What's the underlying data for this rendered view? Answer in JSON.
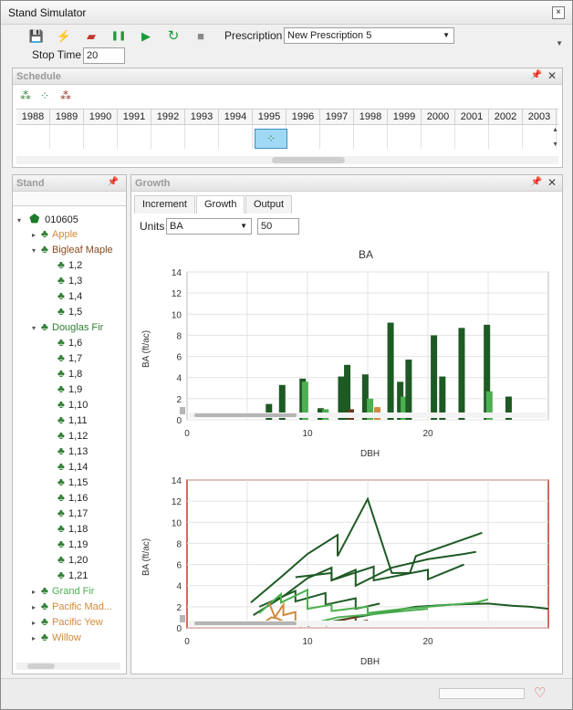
{
  "window": {
    "title": "Stand Simulator"
  },
  "toolbar": {
    "buttons": [
      {
        "name": "save-icon",
        "glyph": "💾",
        "color": "#333"
      },
      {
        "name": "lightning-icon",
        "glyph": "⚡",
        "color": "#d6a400"
      },
      {
        "name": "eraser-icon",
        "glyph": "▰",
        "color": "#c0392b"
      },
      {
        "name": "pause-icon",
        "glyph": "❚❚",
        "color": "#1e9b3a"
      },
      {
        "name": "play-icon",
        "glyph": "▶",
        "color": "#1e9b3a"
      },
      {
        "name": "refresh-icon",
        "glyph": "↻",
        "color": "#1e9b3a"
      },
      {
        "name": "stop-icon",
        "glyph": "■",
        "color": "#8a8a8a"
      }
    ],
    "prescription_label": "Prescription",
    "prescription_value": "New Prescription 5",
    "stop_time_label": "Stop Time",
    "stop_time_value": "20"
  },
  "schedule": {
    "title": "Schedule",
    "years": [
      "1988",
      "1989",
      "1990",
      "1991",
      "1992",
      "1993",
      "1994",
      "1995",
      "1996",
      "1997",
      "1998",
      "1999",
      "2000",
      "2001",
      "2002",
      "2003"
    ],
    "event_year": "1995"
  },
  "stand": {
    "title": "Stand",
    "root": "010605",
    "items": [
      {
        "label": "Apple",
        "level": 1,
        "expander": "▸",
        "color": "#d08a3c"
      },
      {
        "label": "Bigleaf Maple",
        "level": 1,
        "expander": "▾",
        "color": "#8a4a1c"
      },
      {
        "label": "1,2",
        "level": 2,
        "expander": "",
        "color": "#222"
      },
      {
        "label": "1,3",
        "level": 2,
        "expander": "",
        "color": "#222"
      },
      {
        "label": "1,4",
        "level": 2,
        "expander": "",
        "color": "#222"
      },
      {
        "label": "1,5",
        "level": 2,
        "expander": "",
        "color": "#222"
      },
      {
        "label": "Douglas Fir",
        "level": 1,
        "expander": "▾",
        "color": "#2e7d32"
      },
      {
        "label": "1,6",
        "level": 2,
        "expander": "",
        "color": "#222"
      },
      {
        "label": "1,7",
        "level": 2,
        "expander": "",
        "color": "#222"
      },
      {
        "label": "1,8",
        "level": 2,
        "expander": "",
        "color": "#222"
      },
      {
        "label": "1,9",
        "level": 2,
        "expander": "",
        "color": "#222"
      },
      {
        "label": "1,10",
        "level": 2,
        "expander": "",
        "color": "#222"
      },
      {
        "label": "1,11",
        "level": 2,
        "expander": "",
        "color": "#222"
      },
      {
        "label": "1,12",
        "level": 2,
        "expander": "",
        "color": "#222"
      },
      {
        "label": "1,13",
        "level": 2,
        "expander": "",
        "color": "#222"
      },
      {
        "label": "1,14",
        "level": 2,
        "expander": "",
        "color": "#222"
      },
      {
        "label": "1,15",
        "level": 2,
        "expander": "",
        "color": "#222"
      },
      {
        "label": "1,16",
        "level": 2,
        "expander": "",
        "color": "#222"
      },
      {
        "label": "1,17",
        "level": 2,
        "expander": "",
        "color": "#222"
      },
      {
        "label": "1,18",
        "level": 2,
        "expander": "",
        "color": "#222"
      },
      {
        "label": "1,19",
        "level": 2,
        "expander": "",
        "color": "#222"
      },
      {
        "label": "1,20",
        "level": 2,
        "expander": "",
        "color": "#222"
      },
      {
        "label": "1,21",
        "level": 2,
        "expander": "",
        "color": "#222"
      },
      {
        "label": "Grand Fir",
        "level": 1,
        "expander": "▸",
        "color": "#4caf50"
      },
      {
        "label": "Pacific Mad...",
        "level": 1,
        "expander": "▸",
        "color": "#d08a3c"
      },
      {
        "label": "Pacific Yew",
        "level": 1,
        "expander": "▸",
        "color": "#d08a3c"
      },
      {
        "label": "Willow",
        "level": 1,
        "expander": "▸",
        "color": "#d08a3c"
      }
    ]
  },
  "growth": {
    "title": "Growth",
    "tabs": [
      "Increment",
      "Growth",
      "Output"
    ],
    "active_tab": "Growth",
    "units_label": "Units",
    "units_value": "BA",
    "units_number": "50"
  },
  "chart_data": [
    {
      "type": "bar",
      "title": "BA",
      "xlabel": "DBH",
      "ylabel": "BA (ft/ac)",
      "xlim": [
        0,
        30
      ],
      "ylim": [
        0,
        14
      ],
      "xticks": [
        0,
        10,
        20
      ],
      "yticks": [
        0,
        2,
        4,
        6,
        8,
        10,
        12,
        14
      ],
      "grid": true,
      "bars": [
        {
          "x": 6.8,
          "y": 1.5,
          "color": "#1e5a24"
        },
        {
          "x": 7.9,
          "y": 3.3,
          "color": "#1e5a24"
        },
        {
          "x": 9.6,
          "y": 3.9,
          "color": "#1e5a24"
        },
        {
          "x": 9.8,
          "y": 3.6,
          "color": "#4caf50"
        },
        {
          "x": 11.1,
          "y": 1.1,
          "color": "#1e5a24"
        },
        {
          "x": 11.5,
          "y": 1.0,
          "color": "#4caf50"
        },
        {
          "x": 12.8,
          "y": 4.1,
          "color": "#1e5a24"
        },
        {
          "x": 13.3,
          "y": 5.2,
          "color": "#1e5a24"
        },
        {
          "x": 13.6,
          "y": 1.0,
          "color": "#6b3a1c"
        },
        {
          "x": 14.8,
          "y": 4.3,
          "color": "#1e5a24"
        },
        {
          "x": 15.2,
          "y": 2.0,
          "color": "#4caf50"
        },
        {
          "x": 15.8,
          "y": 1.2,
          "color": "#d08a3c"
        },
        {
          "x": 16.9,
          "y": 9.2,
          "color": "#1e5a24"
        },
        {
          "x": 17.7,
          "y": 3.6,
          "color": "#1e5a24"
        },
        {
          "x": 18.0,
          "y": 2.2,
          "color": "#4caf50"
        },
        {
          "x": 18.4,
          "y": 5.7,
          "color": "#1e5a24"
        },
        {
          "x": 20.5,
          "y": 8.0,
          "color": "#1e5a24"
        },
        {
          "x": 21.2,
          "y": 4.1,
          "color": "#1e5a24"
        },
        {
          "x": 22.8,
          "y": 8.7,
          "color": "#1e5a24"
        },
        {
          "x": 24.9,
          "y": 9.0,
          "color": "#1e5a24"
        },
        {
          "x": 25.1,
          "y": 2.7,
          "color": "#4caf50"
        },
        {
          "x": 26.7,
          "y": 2.2,
          "color": "#1e5a24"
        }
      ]
    },
    {
      "type": "line",
      "title": "",
      "xlabel": "DBH",
      "ylabel": "BA (ft/ac)",
      "xlim": [
        0,
        30
      ],
      "ylim": [
        0,
        14
      ],
      "xticks": [
        0,
        10,
        20
      ],
      "yticks": [
        0,
        2,
        4,
        6,
        8,
        10,
        12,
        14
      ],
      "grid": true,
      "series": [
        {
          "color": "#1e5a24",
          "points": [
            [
              5.3,
              2.4
            ],
            [
              8,
              5
            ],
            [
              10,
              7
            ],
            [
              12.5,
              8.8
            ],
            [
              12.5,
              6.8
            ],
            [
              15,
              12.2
            ],
            [
              17,
              5.2
            ],
            [
              18.5,
              5.2
            ],
            [
              19,
              6.8
            ],
            [
              23,
              8.4
            ],
            [
              24.5,
              9
            ]
          ]
        },
        {
          "color": "#1e5a24",
          "points": [
            [
              5.5,
              1.2
            ],
            [
              8,
              3
            ],
            [
              10,
              4.7
            ],
            [
              12,
              5.7
            ],
            [
              12,
              4.5
            ],
            [
              14,
              5.5
            ],
            [
              14,
              4
            ],
            [
              17,
              5.7
            ],
            [
              20,
              6.5
            ],
            [
              23,
              7
            ],
            [
              24,
              7.2
            ]
          ]
        },
        {
          "color": "#1e5a24",
          "points": [
            [
              9,
              4.8
            ],
            [
              12,
              5.2
            ],
            [
              12,
              4.5
            ],
            [
              15.5,
              5.8
            ],
            [
              15.5,
              4.5
            ],
            [
              20,
              5.5
            ],
            [
              20,
              4.6
            ],
            [
              23,
              6
            ]
          ]
        },
        {
          "color": "#1e5a24",
          "points": [
            [
              10,
              0.2
            ],
            [
              14,
              1
            ],
            [
              17,
              1.6
            ],
            [
              19,
              2
            ],
            [
              22,
              2.2
            ],
            [
              25,
              2.3
            ],
            [
              27,
              2.1
            ],
            [
              28.5,
              2
            ],
            [
              30,
              1.8
            ]
          ]
        },
        {
          "color": "#1e5a24",
          "points": [
            [
              6,
              2
            ],
            [
              9,
              3.5
            ],
            [
              9,
              2.5
            ],
            [
              11.5,
              3.3
            ],
            [
              11.5,
              2.2
            ],
            [
              14,
              2.8
            ],
            [
              14,
              1.8
            ],
            [
              16,
              2.3
            ]
          ]
        },
        {
          "color": "#4caf50",
          "points": [
            [
              6,
              1.4
            ],
            [
              7.8,
              3.2
            ],
            [
              7.8,
              2.4
            ],
            [
              10,
              3.6
            ],
            [
              10,
              1.8
            ],
            [
              12,
              2.2
            ],
            [
              12,
              1.6
            ],
            [
              15,
              2
            ],
            [
              15,
              1.4
            ],
            [
              18,
              1.8
            ],
            [
              20,
              2
            ],
            [
              24,
              2.4
            ],
            [
              25,
              2.7
            ]
          ]
        },
        {
          "color": "#4caf50",
          "points": [
            [
              10,
              0.3
            ],
            [
              12.5,
              1
            ],
            [
              15.5,
              1.3
            ],
            [
              18,
              1.6
            ],
            [
              20,
              1.8
            ]
          ]
        },
        {
          "color": "#d08a3c",
          "points": [
            [
              6.8,
              2.4
            ],
            [
              7.3,
              1
            ],
            [
              8,
              2.2
            ],
            [
              8,
              1.2
            ],
            [
              9,
              1.5
            ],
            [
              9,
              0.4
            ],
            [
              9.5,
              0.2
            ]
          ]
        },
        {
          "color": "#d08a3c",
          "points": [
            [
              6.5,
              0.6
            ],
            [
              7,
              1
            ],
            [
              7.5,
              0.9
            ],
            [
              8,
              0.6
            ]
          ]
        },
        {
          "color": "#6b3a1c",
          "points": [
            [
              11.5,
              0.2
            ],
            [
              12.5,
              0.6
            ],
            [
              13.5,
              0.9
            ],
            [
              14,
              1
            ],
            [
              14,
              0.5
            ],
            [
              15,
              0.7
            ]
          ]
        }
      ]
    }
  ]
}
